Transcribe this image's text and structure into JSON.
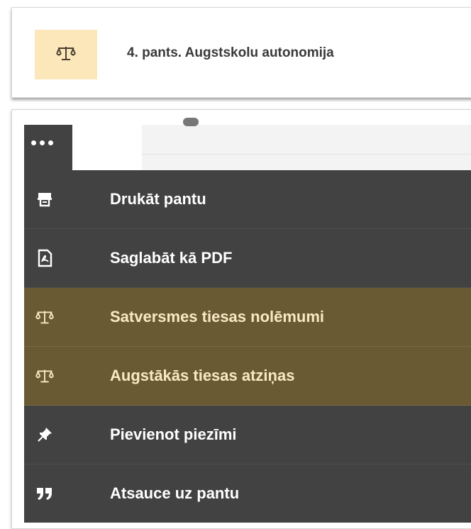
{
  "header": {
    "icon": "scales-icon",
    "title": "4. pants. Augstskolu autonomija"
  },
  "menu": {
    "toggle_icon": "more-dots-icon",
    "items": [
      {
        "icon": "print-icon",
        "label": "Drukāt pantu",
        "highlighted": false
      },
      {
        "icon": "pdf-icon",
        "label": "Saglabāt kā PDF",
        "highlighted": false
      },
      {
        "icon": "scales-icon",
        "label": "Satversmes tiesas nolēmumi",
        "highlighted": true
      },
      {
        "icon": "scales-icon",
        "label": "Augstākās tiesas atziņas",
        "highlighted": true
      },
      {
        "icon": "pin-icon",
        "label": "Pievienot piezīmi",
        "highlighted": false
      },
      {
        "icon": "quote-icon",
        "label": "Atsauce uz pantu",
        "highlighted": false
      }
    ]
  },
  "colors": {
    "menu_bg": "#424242",
    "highlight_bg": "#6a5a34",
    "highlight_text": "#fae8c4",
    "header_icon_bg": "#fbe7b9"
  }
}
